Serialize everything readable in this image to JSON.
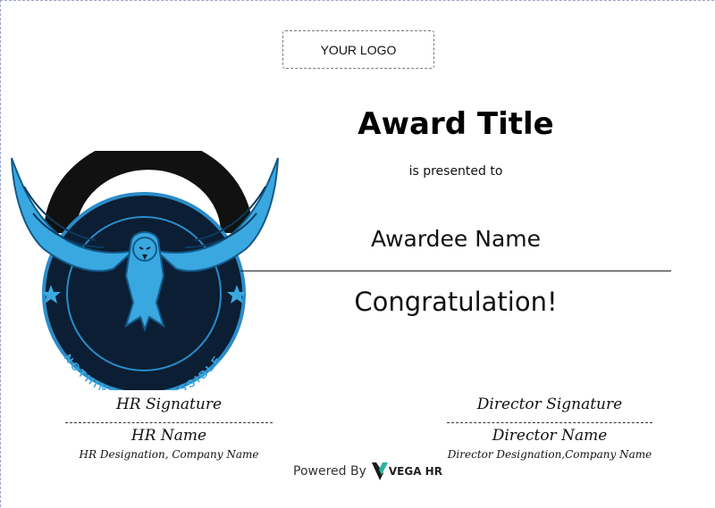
{
  "header": {
    "logo_placeholder": "YOUR LOGO"
  },
  "emblem": {
    "icon": "eagle-emblem-icon",
    "motto": "NOTHING IS IMPOSSIBLE",
    "colors": {
      "primary": "#3aa8e0",
      "dark": "#0b1e33",
      "ring": "#111111"
    }
  },
  "award": {
    "title": "Award Title",
    "presented_text": "is presented to",
    "awardee_name": "Awardee Name",
    "congrats_text": "Congratulation!"
  },
  "signatures": {
    "left": {
      "label": "HR Signature",
      "name": "HR Name",
      "designation": "HR Designation, Company Name"
    },
    "right": {
      "label": "Director Signature",
      "name": "Director Name",
      "designation": "Director Designation,Company Name"
    }
  },
  "footer": {
    "powered_text": "Powered By",
    "brand": "VEGA HR",
    "brand_icon": "vega-hr-logo-icon"
  }
}
